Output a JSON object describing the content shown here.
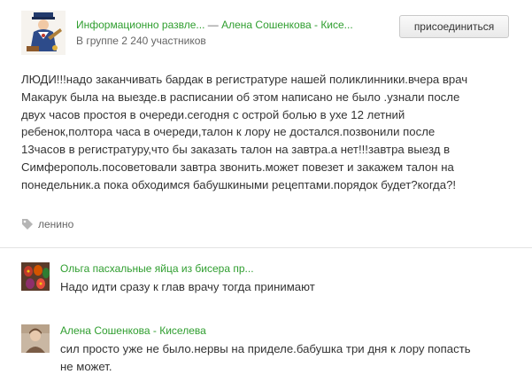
{
  "group": {
    "name": "Информационно развле...",
    "separator": "—",
    "author": "Алена Сошенкова - Кисе...",
    "members_text": "В группе 2 240 участников",
    "join_label": "присоединиться"
  },
  "post": {
    "lines": [
      "ЛЮДИ!!!надо заканчивать бардак в регистратуре нашей поликлинники.вчера врач",
      "Макарук была на выезде.в расписании об этом написано не было .узнали после",
      "двух часов простоя в очереди.сегодня с острой болью в ухе 12 летний",
      "ребенок,полтора часа в очереди,талон к лору не достался.позвонили после",
      "13часов в регистратуру,что бы заказать талон на завтра.а нет!!!завтра выезд в",
      "Симферополь.посоветовали завтра звонить.может повезет и закажем талон на",
      "понедельник.а пока обходимся бабушкиными рецептами.порядок будет?когда?!"
    ],
    "tag": "ленино"
  },
  "comments": [
    {
      "author": "Ольга пасхальные яйца из бисера пр...",
      "lines": [
        "Надо идти сразу к глав врачу тогда принимают"
      ]
    },
    {
      "author": "Алена Сошенкова - Киселева",
      "lines": [
        "сил просто уже не было.нервы на приделе.бабушка три дня к лору попасть",
        "не может."
      ]
    }
  ],
  "colors": {
    "link": "#2f9e2f",
    "text": "#333333",
    "muted": "#666666",
    "divider": "#e3e3e3"
  },
  "icons": {
    "group_avatar": "cartoon-character-avatar",
    "tag": "tag-icon",
    "comment_1_avatar": "beaded-easter-eggs-photo",
    "comment_2_avatar": "user-photo"
  }
}
